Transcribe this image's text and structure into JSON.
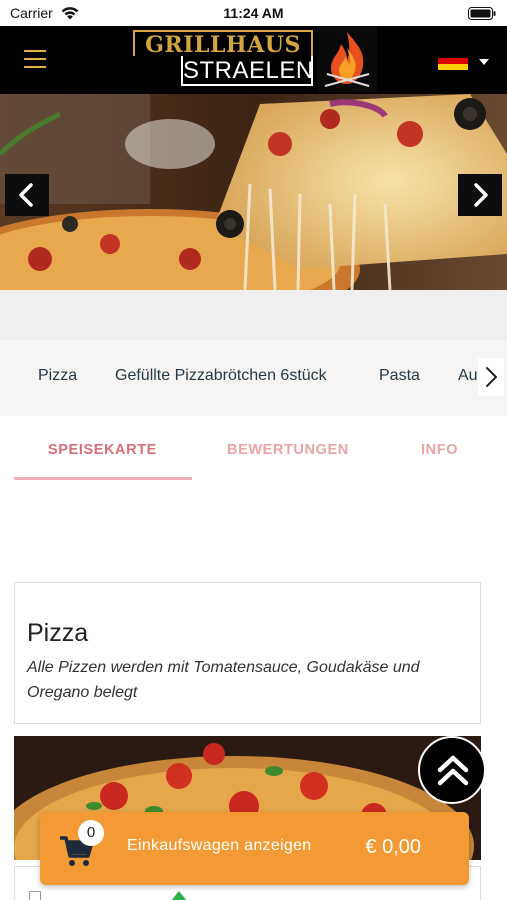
{
  "status_bar": {
    "carrier": "Carrier",
    "time": "11:24 AM",
    "icons": [
      "wifi-icon",
      "battery-icon"
    ]
  },
  "header": {
    "menu_icon": "hamburger-menu-icon",
    "logo_line1": "GRILLHAUS",
    "logo_line2": "STRAELEN",
    "logo_icon": "flame-icon",
    "language_flag": "german-flag-icon",
    "colors": {
      "background": "#000000",
      "logo_gold": "#d4a640",
      "menu": "#e2b13c"
    }
  },
  "hero": {
    "image": "pizza-cheese-pull-photo",
    "prev_icon": "chevron-left-icon",
    "next_icon": "chevron-right-icon"
  },
  "categories": {
    "items": [
      "Pizza",
      "Gefüllte Pizzabrötchen 6stück",
      "Pasta",
      "Au"
    ],
    "scroll_icon": "chevron-right-icon"
  },
  "tabs": {
    "items": [
      "SPEISEKARTE",
      "BEWERTUNGEN",
      "INFO"
    ],
    "active": "SPEISEKARTE",
    "colors": {
      "active": "#d86f78",
      "inactive": "#e9a3a9"
    }
  },
  "section": {
    "title": "Pizza",
    "description": "Alle Pizzen werden mit Tomatensauce, Goudakäse und Oregano belegt",
    "image": "pizza-photo"
  },
  "scroll_top": {
    "icon": "double-chevron-up-icon"
  },
  "cart": {
    "count": "0",
    "label": "Einkaufswagen anzeigen",
    "total": "€ 0,00",
    "icon": "shopping-cart-icon",
    "color": "#f39a35"
  }
}
